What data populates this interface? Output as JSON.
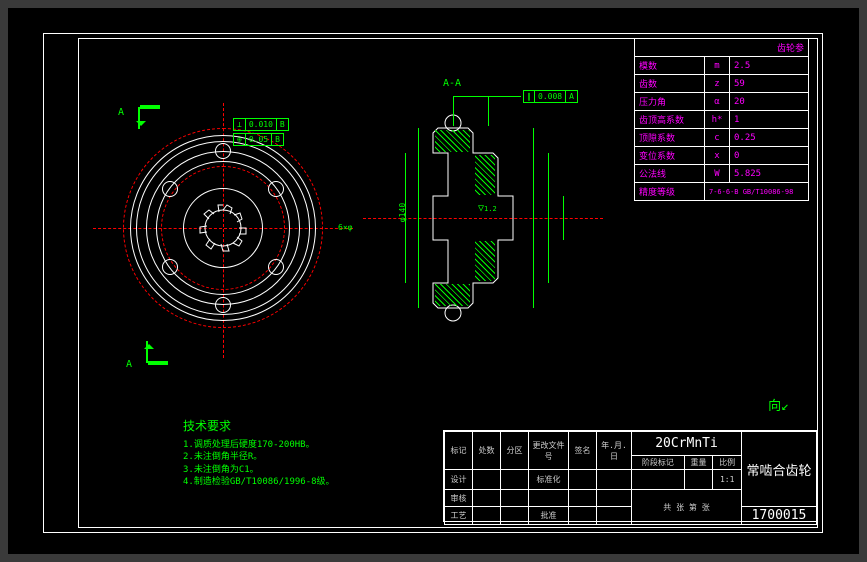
{
  "section_label": "A-A",
  "section_marks": {
    "top": "A",
    "bottom": "A"
  },
  "gd_t": {
    "box1": {
      "sym": "⊥",
      "tol": "0.010",
      "ref": "B"
    },
    "box2": {
      "sym": "⊕",
      "tol": "0.05",
      "ref": "B"
    },
    "box3": {
      "sym": "∥",
      "tol": "0.008",
      "ref": "A"
    }
  },
  "surface_finish": "1.2",
  "dim_note": "6×φ",
  "side_dim": "φ140",
  "tech_requirements": {
    "title": "技术要求",
    "lines": [
      "1.调质处理后硬度170-200HB。",
      "2.未注倒角半径R。",
      "3.未注倒角为C1。",
      "4.制造检验GB/T10086/1996-8级。"
    ]
  },
  "parameters": {
    "header": "齿轮参",
    "rows": [
      {
        "label": "模数",
        "sym": "m",
        "val": "2.5"
      },
      {
        "label": "齿数",
        "sym": "z",
        "val": "59"
      },
      {
        "label": "压力角",
        "sym": "α",
        "val": "20"
      },
      {
        "label": "齿顶高系数",
        "sym": "h*",
        "val": "1"
      },
      {
        "label": "顶隙系数",
        "sym": "c",
        "val": "0.25"
      },
      {
        "label": "变位系数",
        "sym": "x",
        "val": "0"
      },
      {
        "label": "公法线",
        "sym": "W",
        "val": "5.825"
      },
      {
        "label": "精度等级",
        "sym": "",
        "val": "7-6-6-B GB/T10086-98"
      }
    ]
  },
  "title_block": {
    "material": "20CrMnTi",
    "part_name": "常啮合齿轮",
    "drawing_no": "1700015",
    "scale": "1:1",
    "cols": {
      "mark": "标记",
      "zone": "处数",
      "div": "分区",
      "changedoc": "更改文件号",
      "sign": "签名",
      "date": "年.月.日",
      "design": "设计",
      "std": "标准化",
      "rev": "审核",
      "appr": "批准",
      "proc": "工艺",
      "stage": "阶段标记",
      "mass": "重量",
      "scale_l": "比例",
      "sheet": "共  张  第  张"
    }
  },
  "datum_mark": "向↙"
}
